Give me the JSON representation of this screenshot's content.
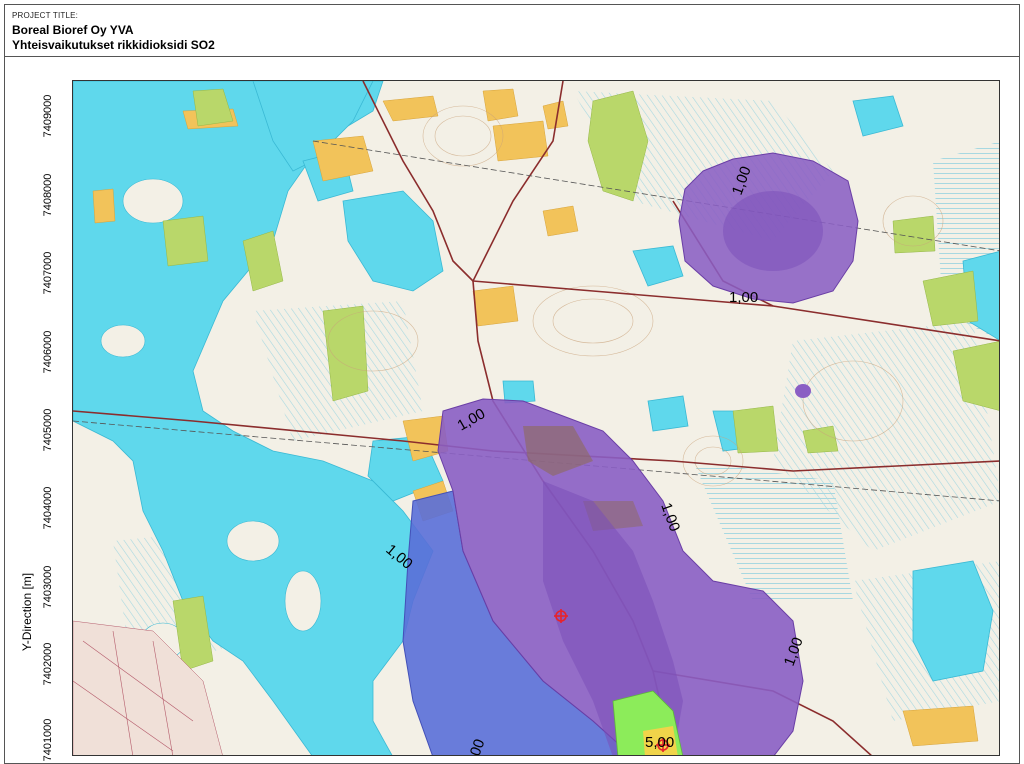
{
  "header": {
    "project_label": "PROJECT TITLE:",
    "title_line1": "Boreal Bioref Oy YVA",
    "title_line2": "Yhteisvaikutukset rikkidioksidi SO2"
  },
  "y_axis": {
    "title": "Y-Direction [m]",
    "ticks": [
      {
        "label": "7409000",
        "value": 7409000
      },
      {
        "label": "7408000",
        "value": 7408000
      },
      {
        "label": "7407000",
        "value": 7407000
      },
      {
        "label": "7406000",
        "value": 7406000
      },
      {
        "label": "7405000",
        "value": 7405000
      },
      {
        "label": "7404000",
        "value": 7404000
      },
      {
        "label": "7403000",
        "value": 7403000
      },
      {
        "label": "7402000",
        "value": 7402000
      },
      {
        "label": "7401000",
        "value": 7401000
      }
    ]
  },
  "contour_labels": [
    {
      "id": "c1",
      "text": "1,00"
    },
    {
      "id": "c2",
      "text": "1,00"
    },
    {
      "id": "c3",
      "text": "1,00"
    },
    {
      "id": "c4",
      "text": "1,00"
    },
    {
      "id": "c5",
      "text": "1,00"
    },
    {
      "id": "c6",
      "text": "1,00"
    },
    {
      "id": "c7",
      "text": "5,00"
    },
    {
      "id": "c8",
      "text": "00"
    }
  ],
  "map_colors": {
    "land": "#f3f0e6",
    "water": "#5fd8ec",
    "wetland_hatch": "#9fd5e0",
    "field": "#f2c35a",
    "forest": "#b9d76a",
    "plume_purple": "#8a5ec4",
    "plume_blue": "#5a6fd8",
    "plume_green": "#8cec5a",
    "plume_high": "#f0d44a",
    "source_marker": "#e8232a",
    "road": "#8b2d2d"
  }
}
